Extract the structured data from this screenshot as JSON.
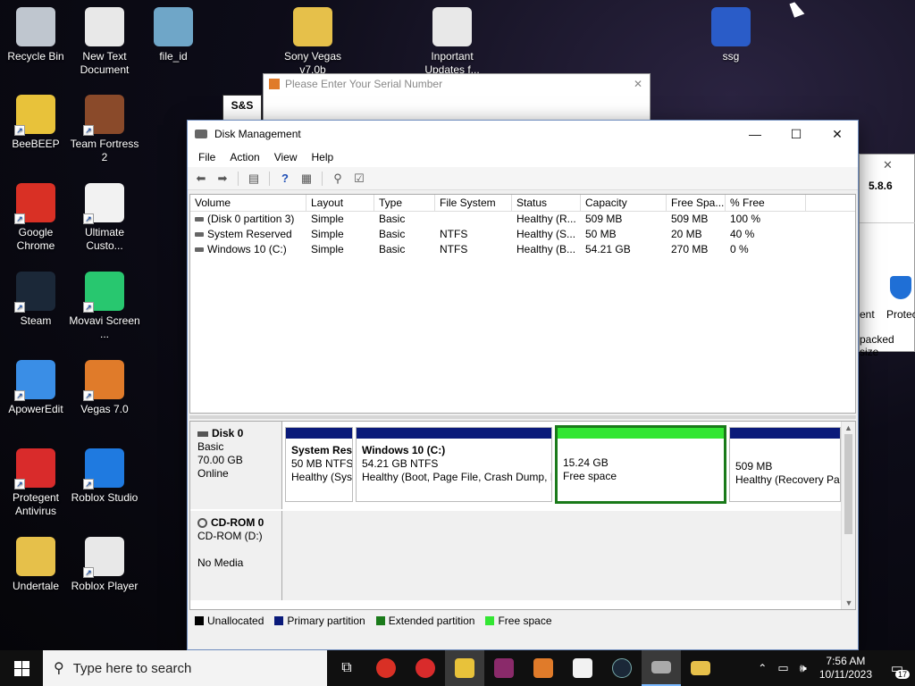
{
  "desktop": {
    "icons": [
      {
        "label": "Recycle Bin",
        "color": "#bfc6cf"
      },
      {
        "label": "New Text Document",
        "color": "#e8e8e8"
      },
      {
        "label": "file_id",
        "color": "#6fa6c8"
      },
      {
        "label": "Sony Vegas v7.0b",
        "color": "#e6c04a"
      },
      {
        "label": "Inportant Updates f...",
        "color": "#e8e8e8"
      },
      {
        "label": "ssg",
        "color": "#2a5cc8"
      },
      {
        "label": "BeeBEEP",
        "color": "#e8c23a"
      },
      {
        "label": "Team Fortress 2",
        "color": "#8a4a2a"
      },
      {
        "label": "Google Chrome",
        "color": "#d93025"
      },
      {
        "label": "Ultimate Custo...",
        "color": "#f2f2f2"
      },
      {
        "label": "Steam",
        "color": "#1b2838"
      },
      {
        "label": "Movavi Screen ...",
        "color": "#28c76f"
      },
      {
        "label": "ApowerEdit",
        "color": "#3a8ee6"
      },
      {
        "label": "Vegas 7.0",
        "color": "#e07b2a"
      },
      {
        "label": "Protegent Antivirus",
        "color": "#d92b2b"
      },
      {
        "label": "Roblox Studio",
        "color": "#1f7ae0"
      },
      {
        "label": "Undertale",
        "color": "#e6c04a"
      },
      {
        "label": "Roblox Player",
        "color": "#e8e8e8"
      }
    ]
  },
  "serial_dialog": {
    "title": "Please Enter Your Serial Number"
  },
  "side_window": {
    "version": "5.8.6",
    "partial_a": "ent",
    "partial_b": "Protec",
    "partial_c": "packed size"
  },
  "window": {
    "title": "Disk Management",
    "minimize": "—",
    "maximize": "☐",
    "close": "✕"
  },
  "menu": [
    "File",
    "Action",
    "View",
    "Help"
  ],
  "table": {
    "columns": [
      "Volume",
      "Layout",
      "Type",
      "File System",
      "Status",
      "Capacity",
      "Free Spa...",
      "% Free"
    ],
    "rows": [
      [
        "(Disk 0 partition 3)",
        "Simple",
        "Basic",
        "",
        "Healthy (R...",
        "509 MB",
        "509 MB",
        "100 %"
      ],
      [
        "System Reserved",
        "Simple",
        "Basic",
        "NTFS",
        "Healthy (S...",
        "50 MB",
        "20 MB",
        "40 %"
      ],
      [
        "Windows 10 (C:)",
        "Simple",
        "Basic",
        "NTFS",
        "Healthy (B...",
        "54.21 GB",
        "270 MB",
        "0 %"
      ]
    ]
  },
  "disk0": {
    "name": "Disk 0",
    "type": "Basic",
    "size": "70.00 GB",
    "state": "Online",
    "partitions": [
      {
        "title": "System Res",
        "size": "50 MB NTFS",
        "status": "Healthy (Sys"
      },
      {
        "title": "Windows 10  (C:)",
        "size": "54.21 GB NTFS",
        "status": "Healthy (Boot, Page File, Crash Dump, I"
      },
      {
        "title": "",
        "size": "15.24 GB",
        "status": "Free space"
      },
      {
        "title": "",
        "size": "509 MB",
        "status": "Healthy (Recovery Pa"
      }
    ]
  },
  "cdrom0": {
    "name": "CD-ROM 0",
    "drive": "CD-ROM (D:)",
    "state": "No Media"
  },
  "legend": {
    "items": [
      {
        "label": "Unallocated",
        "color": "#000000"
      },
      {
        "label": "Primary partition",
        "color": "#0a1a7a"
      },
      {
        "label": "Extended partition",
        "color": "#1a7a1a"
      },
      {
        "label": "Free space",
        "color": "#33e633"
      }
    ]
  },
  "colors": {
    "primary_bar": "#0a1a7a",
    "free_bar": "#33e633",
    "free_border": "#1a7a1a"
  },
  "taskbar": {
    "search_placeholder": "Type here to search",
    "time": "7:56 AM",
    "date": "10/11/2023",
    "notifications": "17"
  }
}
